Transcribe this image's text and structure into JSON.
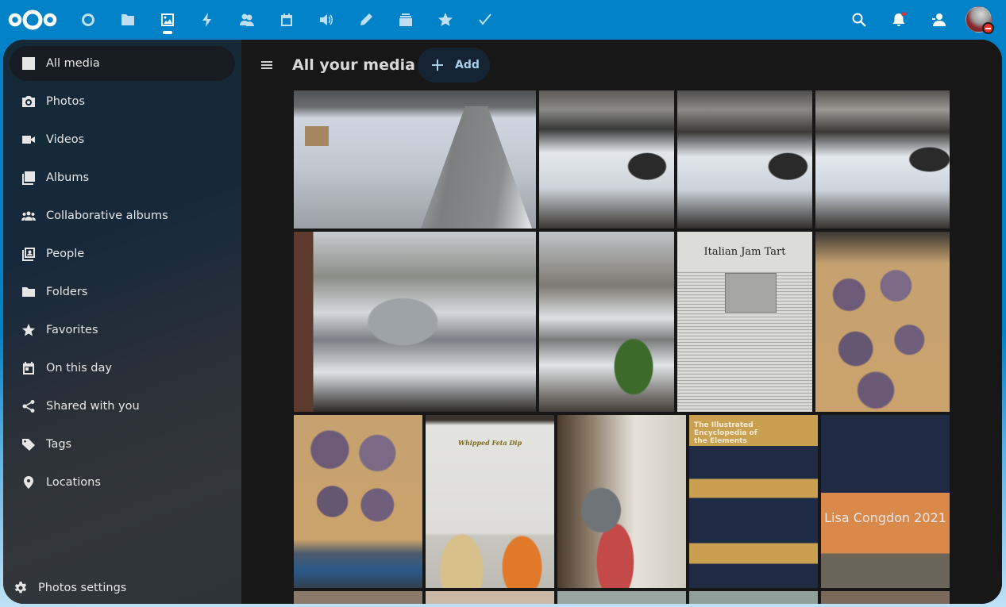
{
  "header": {
    "logo": "nextcloud-logo",
    "apps": [
      {
        "name": "dashboard",
        "icon": "circle-icon",
        "active": false
      },
      {
        "name": "files",
        "icon": "folder-icon",
        "active": false
      },
      {
        "name": "photos",
        "icon": "image-icon",
        "active": true
      },
      {
        "name": "activity",
        "icon": "lightning-icon",
        "active": false
      },
      {
        "name": "contacts",
        "icon": "contacts-icon",
        "active": false
      },
      {
        "name": "calendar",
        "icon": "calendar-icon",
        "active": false
      },
      {
        "name": "announcements",
        "icon": "speaker-icon",
        "active": false
      },
      {
        "name": "notes",
        "icon": "pencil-icon",
        "active": false
      },
      {
        "name": "deck",
        "icon": "deck-icon",
        "active": false
      },
      {
        "name": "bookmarks",
        "icon": "star-icon",
        "active": false
      },
      {
        "name": "tasks",
        "icon": "checkmark-icon",
        "active": false
      }
    ],
    "right": {
      "search": "search-icon",
      "notifications": "bell-icon",
      "contacts_menu": "contacts-menu-icon",
      "user_status": "do-not-disturb"
    }
  },
  "sidebar": {
    "items": [
      {
        "label": "All media",
        "icon": "image-icon",
        "active": true
      },
      {
        "label": "Photos",
        "icon": "camera-icon",
        "active": false
      },
      {
        "label": "Videos",
        "icon": "video-icon",
        "active": false
      },
      {
        "label": "Albums",
        "icon": "albums-icon",
        "active": false
      },
      {
        "label": "Collaborative albums",
        "icon": "group-icon",
        "active": false
      },
      {
        "label": "People",
        "icon": "people-icon",
        "active": false
      },
      {
        "label": "Folders",
        "icon": "folder-icon",
        "active": false
      },
      {
        "label": "Favorites",
        "icon": "star-icon",
        "active": false
      },
      {
        "label": "On this day",
        "icon": "calendar-icon",
        "active": false
      },
      {
        "label": "Shared with you",
        "icon": "share-icon",
        "active": false
      },
      {
        "label": "Tags",
        "icon": "tag-icon",
        "active": false
      },
      {
        "label": "Locations",
        "icon": "map-marker-icon",
        "active": false
      }
    ],
    "settings_label": "Photos settings"
  },
  "main": {
    "title": "All your media",
    "add_label": "Add",
    "photos": [
      {
        "subject": "icy street with sidewalk and folding chair"
      },
      {
        "subject": "snowy yard with person and shrub"
      },
      {
        "subject": "snowy yard with person and railing"
      },
      {
        "subject": "snowy yard with person walking"
      },
      {
        "subject": "silver SUV on snowy driveway"
      },
      {
        "subject": "snowy garden with car and tree"
      },
      {
        "subject": "magazine page",
        "caption": "Italian Jam Tart"
      },
      {
        "subject": "blueberry muffins on tray"
      },
      {
        "subject": "blueberry muffins close-up"
      },
      {
        "subject": "recipe page",
        "caption": "Whipped Feta Dip"
      },
      {
        "subject": "person standing in kitchen"
      },
      {
        "subject": "book cover",
        "caption": "The Illustrated Encyclopedia of the Elements"
      },
      {
        "subject": "book cover close-up",
        "caption": "Lisa Congdon 2021"
      }
    ]
  }
}
